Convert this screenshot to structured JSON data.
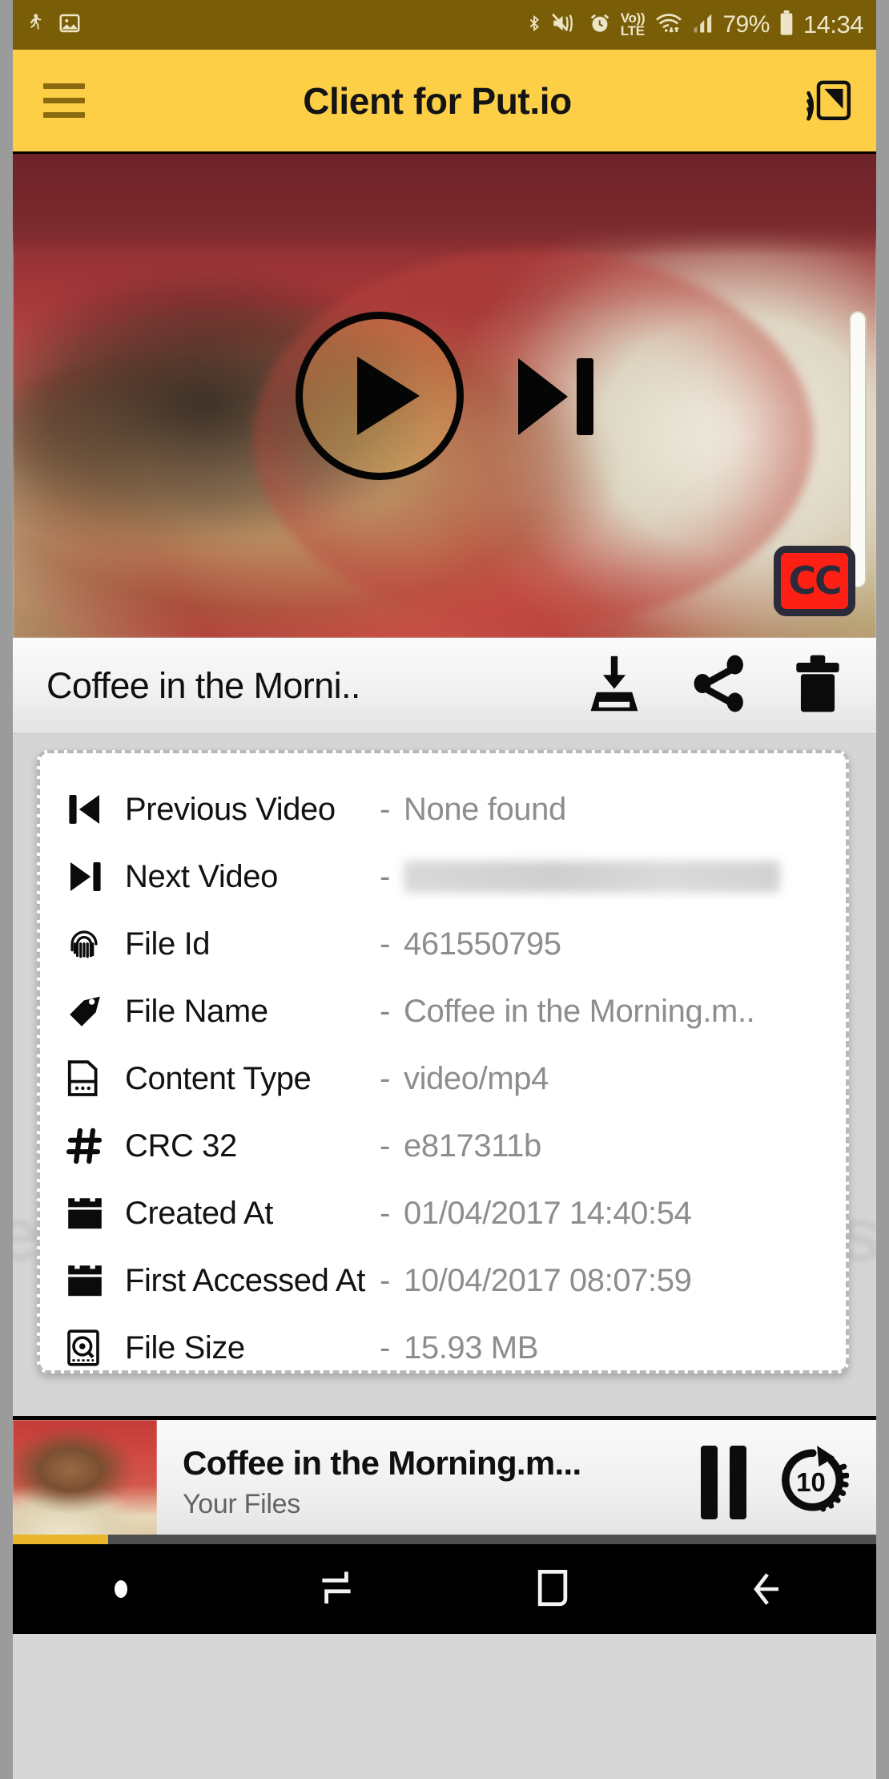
{
  "statusbar": {
    "left_icons": [
      "activity-running-icon",
      "image-icon"
    ],
    "right_icons": [
      "bluetooth-icon",
      "mute-vibrate-icon",
      "alarm-icon",
      "volte-icon",
      "wifi-icon",
      "signal-icon"
    ],
    "volte_top": "Vo))",
    "volte_bottom": "LTE",
    "battery_percent": "79%",
    "clock": "14:34",
    "background_color": "#7a5e07"
  },
  "appbar": {
    "menu_icon": "hamburger-menu-icon",
    "title": "Client for Put.io",
    "cast_icon": "cast-icon",
    "background_color": "#fccf47"
  },
  "video": {
    "play_icon": "play-icon",
    "next_icon": "skip-next-icon",
    "cc_label": "CC",
    "cc_background": "#fe1f15",
    "cc_foreground": "#2b2b3a"
  },
  "filebar": {
    "file_title": "Coffee in the Morni..",
    "actions": [
      {
        "name": "download-button",
        "icon": "download-icon"
      },
      {
        "name": "share-button",
        "icon": "share-icon"
      },
      {
        "name": "delete-button",
        "icon": "trash-icon"
      }
    ]
  },
  "details": {
    "rows": [
      {
        "icon": "skip-previous-icon",
        "label": "Previous Video",
        "dash": "-",
        "value": "None found",
        "blurred": false
      },
      {
        "icon": "skip-next-icon",
        "label": "Next Video",
        "dash": "-",
        "value": "",
        "blurred": true
      },
      {
        "icon": "fingerprint-icon",
        "label": "File Id",
        "dash": "-",
        "value": "461550795",
        "blurred": false
      },
      {
        "icon": "tag-icon",
        "label": "File Name",
        "dash": "-",
        "value": "Coffee in the Morning.m..",
        "blurred": false
      },
      {
        "icon": "file-document-icon",
        "label": "Content Type",
        "dash": "-",
        "value": "video/mp4",
        "blurred": false
      },
      {
        "icon": "hash-icon",
        "label": "CRC 32",
        "dash": "-",
        "value": "e817311b",
        "blurred": false
      },
      {
        "icon": "calendar-icon",
        "label": "Created At",
        "dash": "-",
        "value": "01/04/2017 14:40:54",
        "blurred": false
      },
      {
        "icon": "calendar-icon",
        "label": "First Accessed At",
        "dash": "-",
        "value": "10/04/2017 08:07:59",
        "blurred": false
      },
      {
        "icon": "harddisk-icon",
        "label": "File Size",
        "dash": "-",
        "value": "15.93 MB",
        "blurred": false
      }
    ],
    "watermark_text": "esunesunesunesunesun"
  },
  "miniplayer": {
    "thumbnail": "coffee-cup-thumbnail",
    "title": "Coffee in the Morning.m...",
    "subtitle": "Your Files",
    "pause_icon": "pause-icon",
    "forward_icon": "forward-10-icon",
    "forward_seconds": "10",
    "progress_percent": 11,
    "progress_color": "#e8b52b"
  },
  "navbar": {
    "items": [
      {
        "name": "nav-dot",
        "icon": "dot-icon"
      },
      {
        "name": "nav-recents",
        "icon": "recents-icon"
      },
      {
        "name": "nav-home",
        "icon": "home-icon"
      },
      {
        "name": "nav-back",
        "icon": "back-arrow-icon"
      }
    ]
  }
}
